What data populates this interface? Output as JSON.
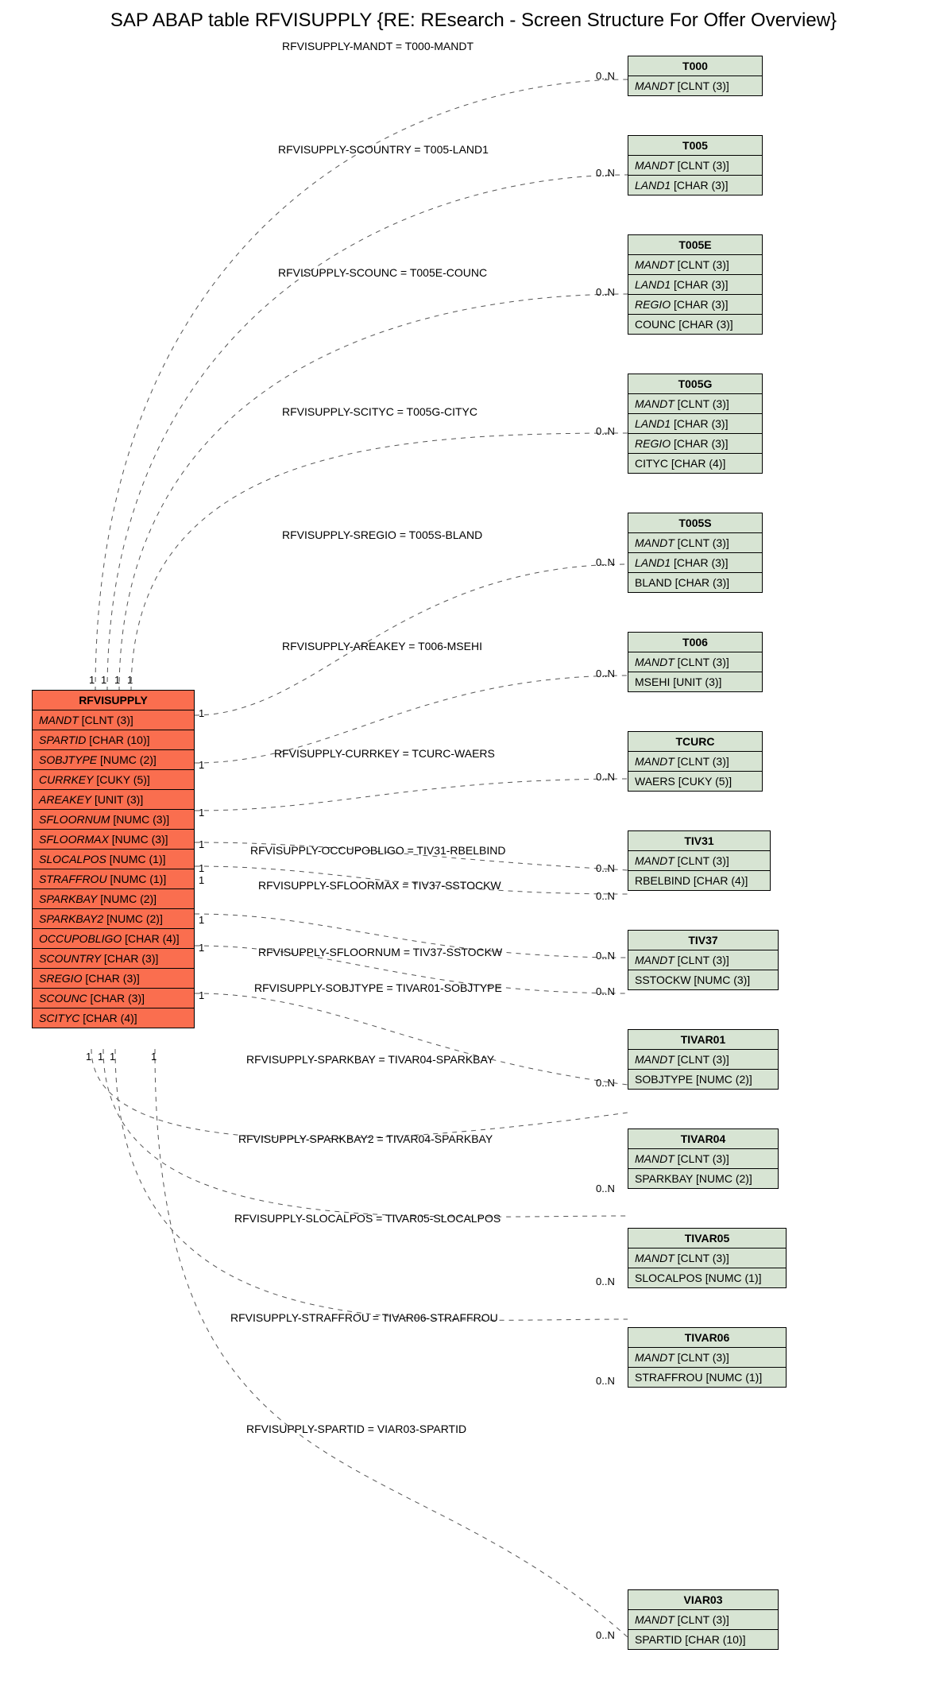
{
  "title": "SAP ABAP table RFVISUPPLY {RE: REsearch - Screen Structure For Offer Overview}",
  "main_table": {
    "name": "RFVISUPPLY",
    "fields": [
      {
        "name": "MANDT",
        "type": "[CLNT (3)]",
        "key": true
      },
      {
        "name": "SPARTID",
        "type": "[CHAR (10)]",
        "key": true
      },
      {
        "name": "SOBJTYPE",
        "type": "[NUMC (2)]",
        "key": true
      },
      {
        "name": "CURRKEY",
        "type": "[CUKY (5)]",
        "key": true
      },
      {
        "name": "AREAKEY",
        "type": "[UNIT (3)]",
        "key": true
      },
      {
        "name": "SFLOORNUM",
        "type": "[NUMC (3)]",
        "key": true
      },
      {
        "name": "SFLOORMAX",
        "type": "[NUMC (3)]",
        "key": true
      },
      {
        "name": "SLOCALPOS",
        "type": "[NUMC (1)]",
        "key": true
      },
      {
        "name": "STRAFFROU",
        "type": "[NUMC (1)]",
        "key": true
      },
      {
        "name": "SPARKBAY",
        "type": "[NUMC (2)]",
        "key": true
      },
      {
        "name": "SPARKBAY2",
        "type": "[NUMC (2)]",
        "key": true
      },
      {
        "name": "OCCUPOBLIGO",
        "type": "[CHAR (4)]",
        "key": true
      },
      {
        "name": "SCOUNTRY",
        "type": "[CHAR (3)]",
        "key": true
      },
      {
        "name": "SREGIO",
        "type": "[CHAR (3)]",
        "key": true
      },
      {
        "name": "SCOUNC",
        "type": "[CHAR (3)]",
        "key": true
      },
      {
        "name": "SCITYC",
        "type": "[CHAR (4)]",
        "key": true
      }
    ]
  },
  "ref_tables": [
    {
      "name": "T000",
      "fields": [
        {
          "name": "MANDT",
          "type": "[CLNT (3)]",
          "key": true
        }
      ]
    },
    {
      "name": "T005",
      "fields": [
        {
          "name": "MANDT",
          "type": "[CLNT (3)]",
          "key": true
        },
        {
          "name": "LAND1",
          "type": "[CHAR (3)]",
          "key": true
        }
      ]
    },
    {
      "name": "T005E",
      "fields": [
        {
          "name": "MANDT",
          "type": "[CLNT (3)]",
          "key": true
        },
        {
          "name": "LAND1",
          "type": "[CHAR (3)]",
          "key": true
        },
        {
          "name": "REGIO",
          "type": "[CHAR (3)]",
          "key": true
        },
        {
          "name": "COUNC",
          "type": "[CHAR (3)]",
          "key": false
        }
      ]
    },
    {
      "name": "T005G",
      "fields": [
        {
          "name": "MANDT",
          "type": "[CLNT (3)]",
          "key": true
        },
        {
          "name": "LAND1",
          "type": "[CHAR (3)]",
          "key": true
        },
        {
          "name": "REGIO",
          "type": "[CHAR (3)]",
          "key": true
        },
        {
          "name": "CITYC",
          "type": "[CHAR (4)]",
          "key": false
        }
      ]
    },
    {
      "name": "T005S",
      "fields": [
        {
          "name": "MANDT",
          "type": "[CLNT (3)]",
          "key": true
        },
        {
          "name": "LAND1",
          "type": "[CHAR (3)]",
          "key": true
        },
        {
          "name": "BLAND",
          "type": "[CHAR (3)]",
          "key": false
        }
      ]
    },
    {
      "name": "T006",
      "fields": [
        {
          "name": "MANDT",
          "type": "[CLNT (3)]",
          "key": true
        },
        {
          "name": "MSEHI",
          "type": "[UNIT (3)]",
          "key": false
        }
      ]
    },
    {
      "name": "TCURC",
      "fields": [
        {
          "name": "MANDT",
          "type": "[CLNT (3)]",
          "key": true
        },
        {
          "name": "WAERS",
          "type": "[CUKY (5)]",
          "key": false
        }
      ]
    },
    {
      "name": "TIV31",
      "fields": [
        {
          "name": "MANDT",
          "type": "[CLNT (3)]",
          "key": true
        },
        {
          "name": "RBELBIND",
          "type": "[CHAR (4)]",
          "key": false
        }
      ]
    },
    {
      "name": "TIV37",
      "fields": [
        {
          "name": "MANDT",
          "type": "[CLNT (3)]",
          "key": true
        },
        {
          "name": "SSTOCKW",
          "type": "[NUMC (3)]",
          "key": false
        }
      ]
    },
    {
      "name": "TIVAR01",
      "fields": [
        {
          "name": "MANDT",
          "type": "[CLNT (3)]",
          "key": true
        },
        {
          "name": "SOBJTYPE",
          "type": "[NUMC (2)]",
          "key": false
        }
      ]
    },
    {
      "name": "TIVAR04",
      "fields": [
        {
          "name": "MANDT",
          "type": "[CLNT (3)]",
          "key": true
        },
        {
          "name": "SPARKBAY",
          "type": "[NUMC (2)]",
          "key": false
        }
      ]
    },
    {
      "name": "TIVAR05",
      "fields": [
        {
          "name": "MANDT",
          "type": "[CLNT (3)]",
          "key": true
        },
        {
          "name": "SLOCALPOS",
          "type": "[NUMC (1)]",
          "key": false
        }
      ]
    },
    {
      "name": "TIVAR06",
      "fields": [
        {
          "name": "MANDT",
          "type": "[CLNT (3)]",
          "key": true
        },
        {
          "name": "STRAFFROU",
          "type": "[NUMC (1)]",
          "key": false
        }
      ]
    },
    {
      "name": "VIAR03",
      "fields": [
        {
          "name": "MANDT",
          "type": "[CLNT (3)]",
          "key": true
        },
        {
          "name": "SPARTID",
          "type": "[CHAR (10)]",
          "key": false
        }
      ]
    }
  ],
  "edges": [
    {
      "label": "RFVISUPPLY-MANDT = T000-MANDT",
      "card_right": "0..N"
    },
    {
      "label": "RFVISUPPLY-SCOUNTRY = T005-LAND1",
      "card_right": "0..N"
    },
    {
      "label": "RFVISUPPLY-SCOUNC = T005E-COUNC",
      "card_right": "0..N"
    },
    {
      "label": "RFVISUPPLY-SCITYC = T005G-CITYC",
      "card_right": "0..N"
    },
    {
      "label": "RFVISUPPLY-SREGIO = T005S-BLAND",
      "card_right": "0..N"
    },
    {
      "label": "RFVISUPPLY-AREAKEY = T006-MSEHI",
      "card_right": "0..N"
    },
    {
      "label": "RFVISUPPLY-CURRKEY = TCURC-WAERS",
      "card_right": "0..N"
    },
    {
      "label": "RFVISUPPLY-OCCUPOBLIGO = TIV31-RBELBIND",
      "card_right": "0..N"
    },
    {
      "label": "RFVISUPPLY-SFLOORMAX = TIV37-SSTOCKW",
      "card_right": "0..N"
    },
    {
      "label": "RFVISUPPLY-SFLOORNUM = TIV37-SSTOCKW",
      "card_right": "0..N"
    },
    {
      "label": "RFVISUPPLY-SOBJTYPE = TIVAR01-SOBJTYPE",
      "card_right": "0..N"
    },
    {
      "label": "RFVISUPPLY-SPARKBAY = TIVAR04-SPARKBAY",
      "card_right": "0..N"
    },
    {
      "label": "RFVISUPPLY-SPARKBAY2 = TIVAR04-SPARKBAY",
      "card_right": "0..N"
    },
    {
      "label": "RFVISUPPLY-SLOCALPOS = TIVAR05-SLOCALPOS",
      "card_right": "0..N"
    },
    {
      "label": "RFVISUPPLY-STRAFFROU = TIVAR06-STRAFFROU",
      "card_right": "0..N"
    },
    {
      "label": "RFVISUPPLY-SPARTID = VIAR03-SPARTID",
      "card_right": "0..N"
    }
  ],
  "left_cards_top": [
    "1",
    "1",
    "1",
    "1"
  ],
  "left_cards_right": [
    "1",
    "1",
    "1",
    "1",
    "1",
    "1",
    "1",
    "1"
  ],
  "left_cards_bottom": [
    "1",
    "1",
    "1",
    "1"
  ]
}
